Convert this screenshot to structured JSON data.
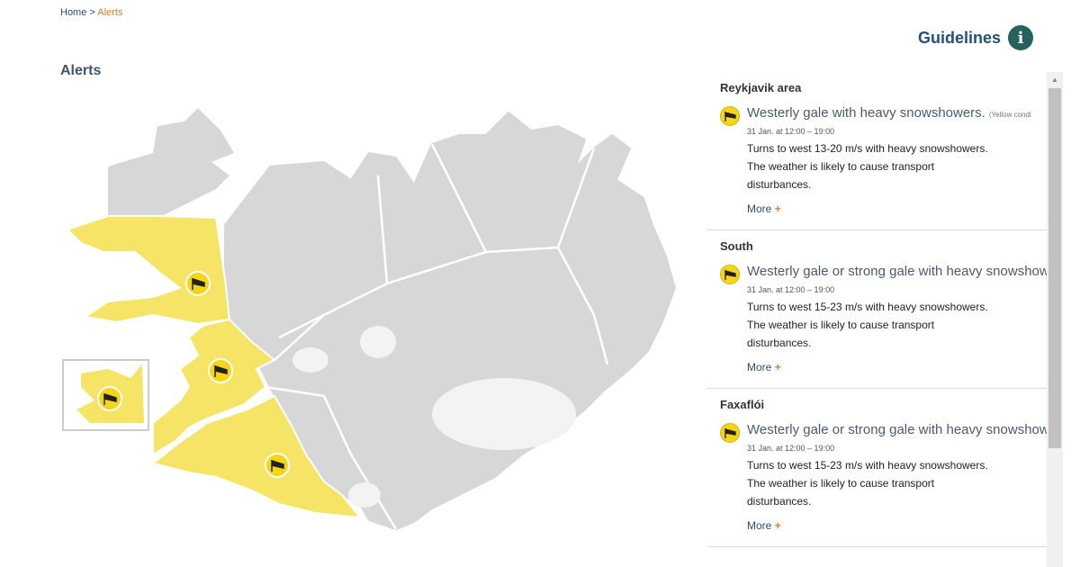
{
  "breadcrumb": {
    "home": "Home",
    "separator": ">",
    "current": "Alerts"
  },
  "guidelines": {
    "label": "Guidelines",
    "icon": "info-icon",
    "icon_glyph": "i"
  },
  "page": {
    "title": "Alerts"
  },
  "map": {
    "land_color": "#d7d7d7",
    "alert_color": "#f6e466",
    "border_color": "#ffffff",
    "marker_icon": "windsock-icon"
  },
  "alerts": [
    {
      "region": "Reykjavik area",
      "title": "Westerly gale with heavy snowshowers.",
      "note": "(Yellow condi",
      "time": "31 Jan. at 12:00 – 19:00",
      "description": "Turns to west 13-20 m/s with heavy snowshowers. The weather is likely to cause transport disturbances.",
      "more": "More",
      "more_icon": "+"
    },
    {
      "region": "South",
      "title": "Westerly gale or strong gale with heavy snowshow",
      "note": "",
      "time": "31 Jan. at 12:00 – 19:00",
      "description": "Turns to west 15-23 m/s with heavy snowshowers. The weather is likely to cause transport disturbances.",
      "more": "More",
      "more_icon": "+"
    },
    {
      "region": "Faxaflói",
      "title": "Westerly gale or strong gale with heavy snowshow",
      "note": "",
      "time": "31 Jan. at 12:00 – 19:00",
      "description": "Turns to west 15-23 m/s with heavy snowshowers. The weather is likely to cause transport disturbances.",
      "more": "More",
      "more_icon": "+"
    }
  ],
  "colors": {
    "accent_orange": "#e8782a",
    "heading_blue": "#23507f",
    "info_teal": "#25625f",
    "alert_yellow": "#f6d416"
  }
}
